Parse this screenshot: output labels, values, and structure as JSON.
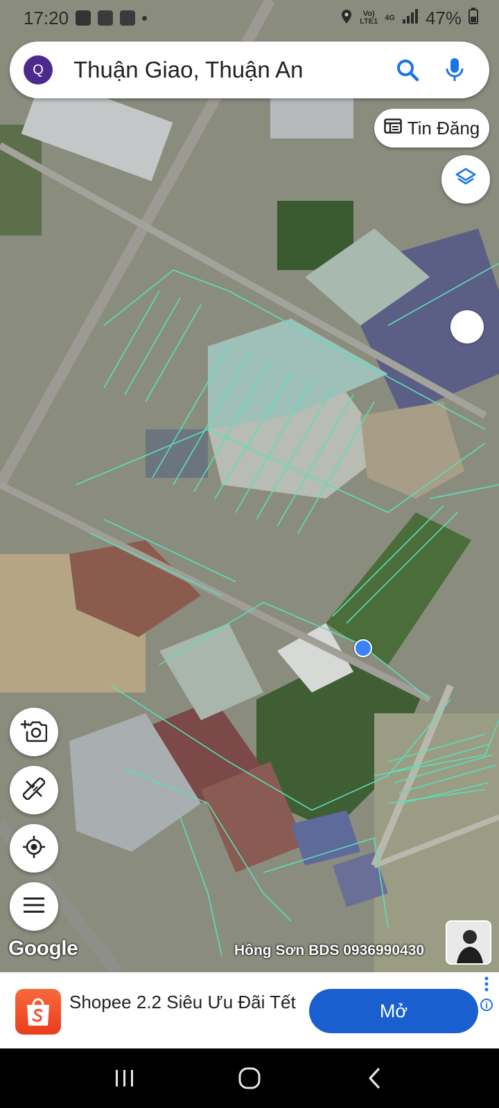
{
  "status_bar": {
    "time": "17:20",
    "network_top": "Vo)",
    "network_bottom": "LTE1",
    "signal_label": "4G",
    "battery": "47%"
  },
  "search": {
    "avatar_letter": "Q",
    "query": "Thuận Giao, Thuận An",
    "icons": [
      "search-icon",
      "microphone-icon"
    ]
  },
  "chip": {
    "label": "Tin Đăng",
    "icon": "listing-icon"
  },
  "map": {
    "logo": "Google",
    "credit": "Hồng Sơn BDS 0936990430",
    "view": "satellite",
    "colors": {
      "parcel_lines": "#58e0b8",
      "location_dot": "#3b82f6"
    }
  },
  "left_tools": [
    "camera-add-icon",
    "measure-tool-icon",
    "my-location-icon",
    "menu-icon"
  ],
  "ad": {
    "title": "Shopee 2.2 Siêu Ưu Đãi Tết",
    "cta": "Mở",
    "info": "i",
    "colors": {
      "cta": "#1a5fd0",
      "brand": "#ee4d2d"
    }
  },
  "nav": [
    "recent-apps-icon",
    "home-icon",
    "back-icon"
  ]
}
